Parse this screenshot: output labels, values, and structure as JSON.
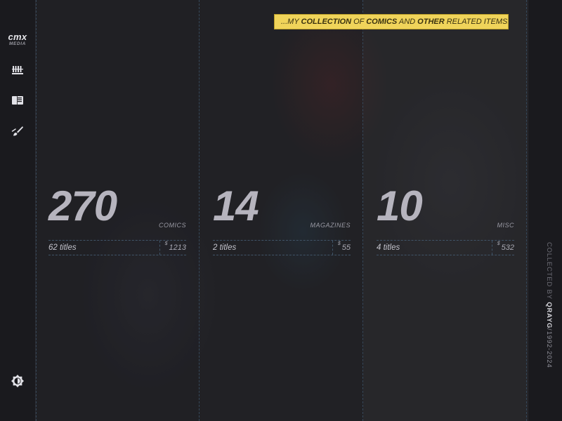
{
  "brand": {
    "name": "cmx",
    "sub": "MEDIA"
  },
  "nav": [
    {
      "icon": "shelves-icon"
    },
    {
      "icon": "book-icon"
    },
    {
      "icon": "brush-icon"
    }
  ],
  "theme_toggle": {
    "icon": "brightness-icon"
  },
  "tagline": {
    "p1": "...MY ",
    "b1": "COLLECTION",
    "p2": " OF ",
    "b2": "COMICS",
    "p3": " AND ",
    "b3": "OTHER",
    "p4": " RELATED ITEMS!"
  },
  "stats": [
    {
      "count": "270",
      "kind": "COMICS",
      "titles": "62 titles",
      "currency": "$",
      "amount": "1213"
    },
    {
      "count": "14",
      "kind": "MAGAZINES",
      "titles": "2 titles",
      "currency": "$",
      "amount": "55"
    },
    {
      "count": "10",
      "kind": "MISC",
      "titles": "4 titles",
      "currency": "$",
      "amount": "532"
    }
  ],
  "credit": {
    "by": "COLLECTED BY",
    "name": "QRAYG",
    "slash": "/",
    "start": "1992",
    "dash": "-",
    "end": "2024"
  },
  "colors": {
    "accent": "#f0d45a",
    "background": "#222226",
    "sidebar": "#1a1a1e"
  }
}
